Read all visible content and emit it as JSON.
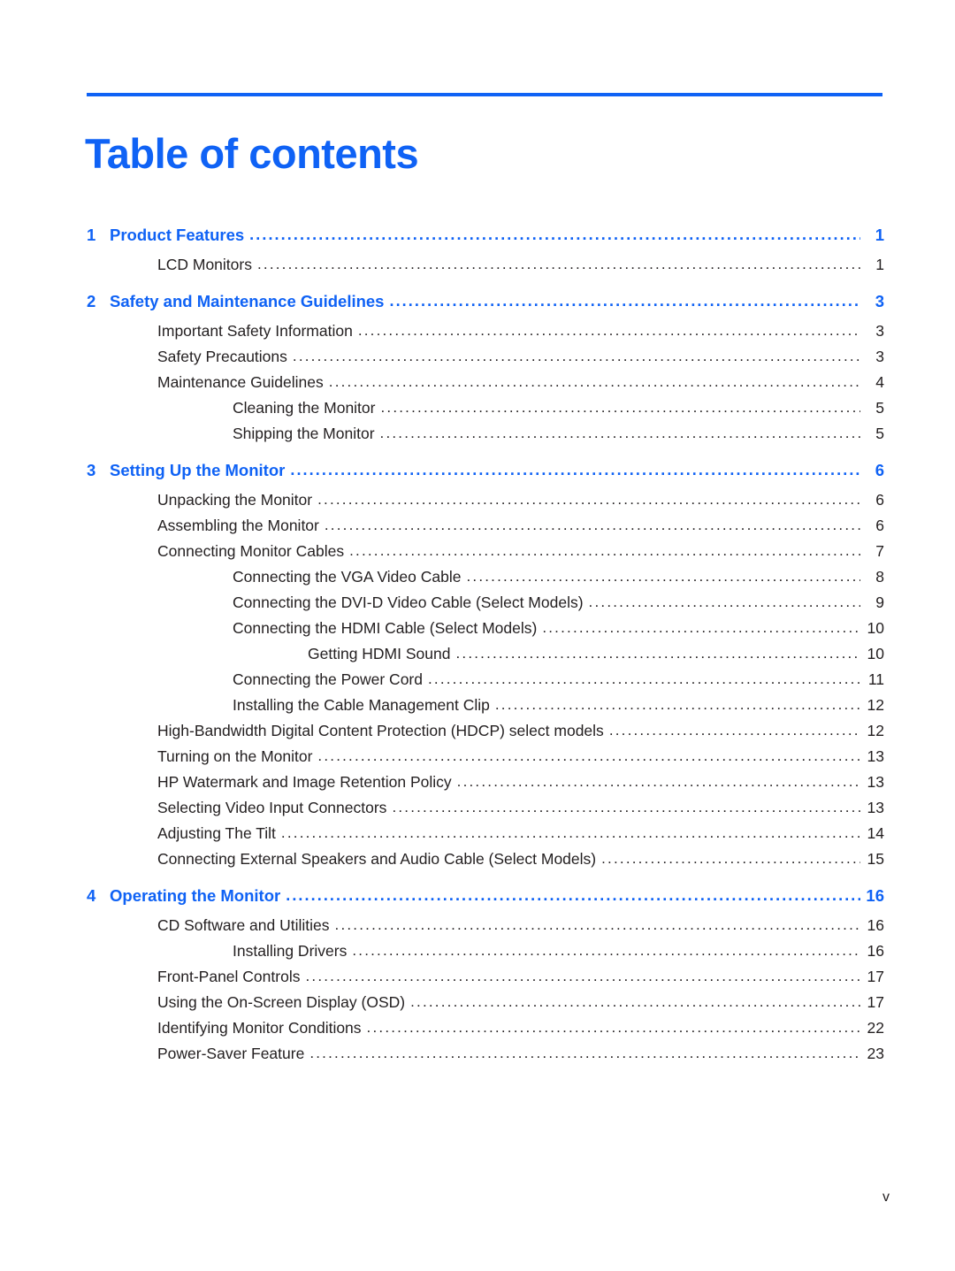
{
  "theme": {
    "brand_color": "#0f62f5",
    "text_color": "#231f20",
    "background": "#ffffff"
  },
  "header": {
    "title": "Table of contents"
  },
  "footer": {
    "page_marker": "v"
  },
  "toc": {
    "leader_char": ".",
    "entries": [
      {
        "level": 1,
        "number": "1",
        "label": "Product Features",
        "page": "1",
        "gap_before": false
      },
      {
        "level": 2,
        "number": "",
        "label": "LCD Monitors",
        "page": "1",
        "gap_before": false
      },
      {
        "level": 1,
        "number": "2",
        "label": "Safety and Maintenance Guidelines",
        "page": "3",
        "gap_before": true
      },
      {
        "level": 2,
        "number": "",
        "label": "Important Safety Information",
        "page": "3",
        "gap_before": false
      },
      {
        "level": 2,
        "number": "",
        "label": "Safety Precautions",
        "page": "3",
        "gap_before": false
      },
      {
        "level": 2,
        "number": "",
        "label": "Maintenance Guidelines",
        "page": "4",
        "gap_before": false
      },
      {
        "level": 3,
        "number": "",
        "label": "Cleaning the Monitor",
        "page": "5",
        "gap_before": false
      },
      {
        "level": 3,
        "number": "",
        "label": "Shipping the Monitor",
        "page": "5",
        "gap_before": false
      },
      {
        "level": 1,
        "number": "3",
        "label": "Setting Up the Monitor",
        "page": "6",
        "gap_before": true
      },
      {
        "level": 2,
        "number": "",
        "label": "Unpacking the Monitor",
        "page": "6",
        "gap_before": false
      },
      {
        "level": 2,
        "number": "",
        "label": "Assembling the Monitor",
        "page": "6",
        "gap_before": false
      },
      {
        "level": 2,
        "number": "",
        "label": "Connecting Monitor Cables",
        "page": "7",
        "gap_before": false
      },
      {
        "level": 3,
        "number": "",
        "label": "Connecting the VGA Video Cable",
        "page": "8",
        "gap_before": false
      },
      {
        "level": 3,
        "number": "",
        "label": "Connecting the DVI-D Video Cable (Select Models)",
        "page": "9",
        "gap_before": false
      },
      {
        "level": 3,
        "number": "",
        "label": "Connecting the HDMI Cable (Select Models)",
        "page": "10",
        "gap_before": false
      },
      {
        "level": 4,
        "number": "",
        "label": "Getting HDMI Sound",
        "page": "10",
        "gap_before": false
      },
      {
        "level": 3,
        "number": "",
        "label": "Connecting the Power Cord",
        "page": "11",
        "gap_before": false
      },
      {
        "level": 3,
        "number": "",
        "label": "Installing the Cable Management Clip",
        "page": "12",
        "gap_before": false
      },
      {
        "level": 2,
        "number": "",
        "label": "High-Bandwidth Digital Content Protection (HDCP) select models",
        "page": "12",
        "gap_before": false
      },
      {
        "level": 2,
        "number": "",
        "label": "Turning on the Monitor",
        "page": "13",
        "gap_before": false
      },
      {
        "level": 2,
        "number": "",
        "label": "HP Watermark and Image Retention Policy",
        "page": "13",
        "gap_before": false
      },
      {
        "level": 2,
        "number": "",
        "label": "Selecting Video Input Connectors",
        "page": "13",
        "gap_before": false
      },
      {
        "level": 2,
        "number": "",
        "label": "Adjusting The Tilt",
        "page": "14",
        "gap_before": false
      },
      {
        "level": 2,
        "number": "",
        "label": "Connecting External Speakers and Audio Cable (Select Models)",
        "page": "15",
        "gap_before": false
      },
      {
        "level": 1,
        "number": "4",
        "label": "Operating the Monitor",
        "page": "16",
        "gap_before": true
      },
      {
        "level": 2,
        "number": "",
        "label": "CD Software and Utilities",
        "page": "16",
        "gap_before": false
      },
      {
        "level": 3,
        "number": "",
        "label": "Installing Drivers",
        "page": "16",
        "gap_before": false
      },
      {
        "level": 2,
        "number": "",
        "label": "Front-Panel Controls",
        "page": "17",
        "gap_before": false
      },
      {
        "level": 2,
        "number": "",
        "label": "Using the On-Screen Display (OSD)",
        "page": "17",
        "gap_before": false
      },
      {
        "level": 2,
        "number": "",
        "label": "Identifying Monitor Conditions",
        "page": "22",
        "gap_before": false
      },
      {
        "level": 2,
        "number": "",
        "label": "Power-Saver Feature",
        "page": "23",
        "gap_before": false
      }
    ]
  }
}
